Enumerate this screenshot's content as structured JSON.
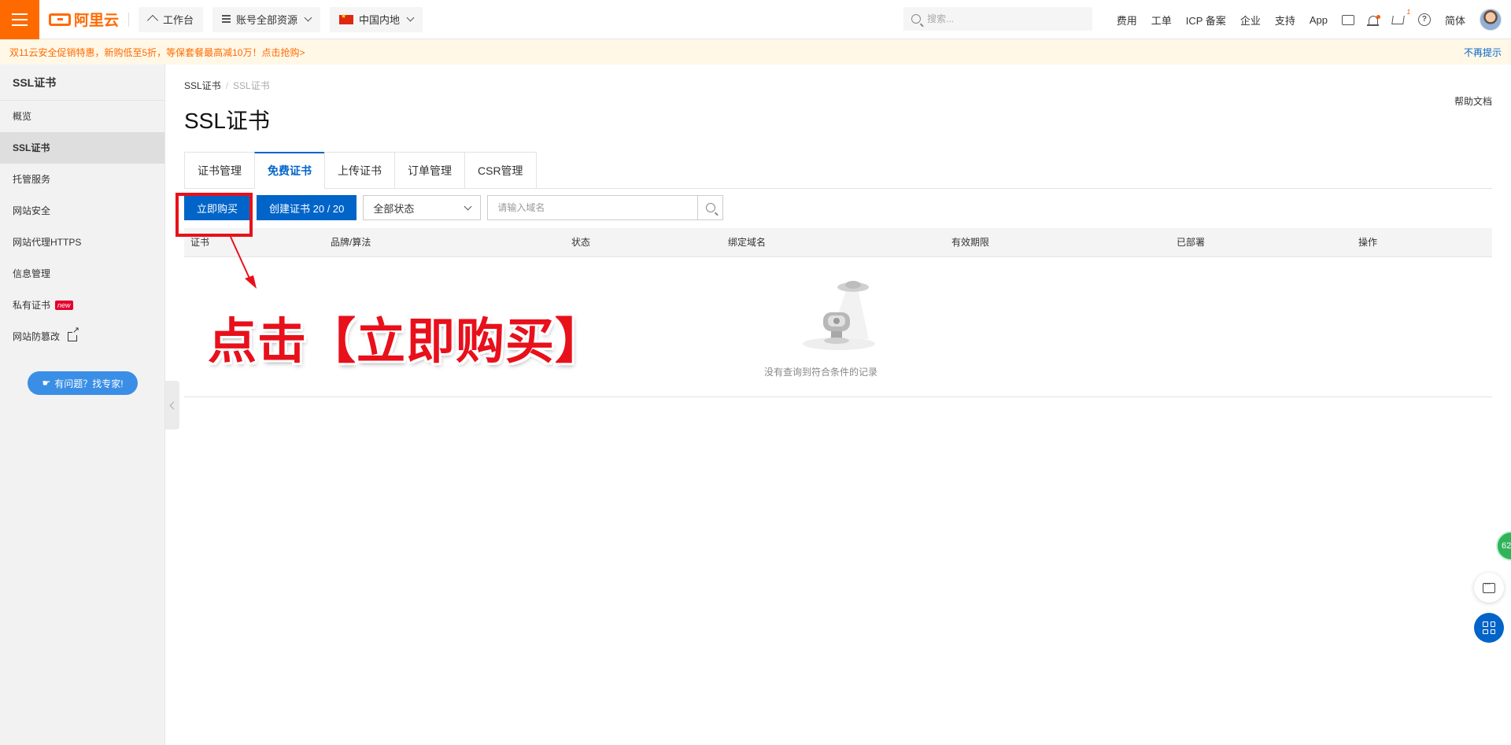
{
  "topbar": {
    "logo_text": "阿里云",
    "workbench": "工作台",
    "resources": "账号全部资源",
    "region": "中国内地",
    "search_placeholder": "搜索...",
    "links": [
      "费用",
      "工单",
      "ICP 备案",
      "企业",
      "支持",
      "App"
    ],
    "cart_count": "1",
    "language": "简体"
  },
  "promo": {
    "text": "双11云安全促销特惠，新购低至5折，等保套餐最高减10万！点击抢购>",
    "dismiss": "不再提示"
  },
  "sidebar": {
    "title": "SSL证书",
    "items": [
      {
        "label": "概览"
      },
      {
        "label": "SSL证书"
      },
      {
        "label": "托管服务"
      },
      {
        "label": "网站安全"
      },
      {
        "label": "网站代理HTTPS"
      },
      {
        "label": "信息管理"
      },
      {
        "label": "私有证书",
        "badge": "new"
      },
      {
        "label": "网站防篡改"
      }
    ],
    "expert_button": "有问题？找专家!"
  },
  "main": {
    "breadcrumb": [
      "SSL证书",
      "SSL证书"
    ],
    "help_doc": "帮助文档",
    "title": "SSL证书",
    "tabs": [
      "证书管理",
      "免费证书",
      "上传证书",
      "订单管理",
      "CSR管理"
    ],
    "active_tab": "免费证书",
    "buy_button": "立即购买",
    "create_button": "创建证书 20 / 20",
    "status_select": "全部状态",
    "domain_placeholder": "请输入域名",
    "columns": [
      "证书",
      "品牌/算法",
      "状态",
      "绑定域名",
      "有效期限",
      "已部署",
      "操作"
    ],
    "empty_text": "没有查询到符合条件的记录"
  },
  "annotation": {
    "text": "点击【立即购买】",
    "color": "#e8101b"
  },
  "floating": {
    "green_badge": "62"
  },
  "colors": {
    "brand": "#ff6a00",
    "primary": "#0064c8"
  }
}
